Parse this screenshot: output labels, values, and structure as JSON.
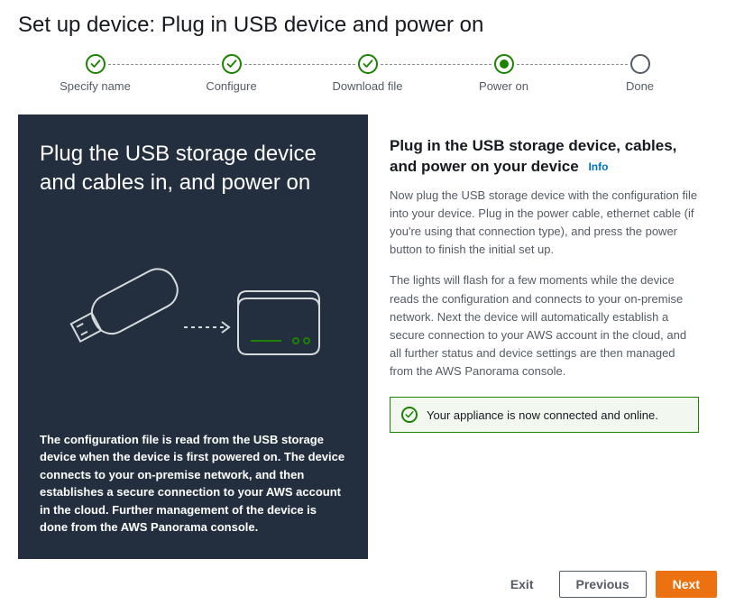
{
  "page": {
    "title": "Set up device: Plug in USB device and power on"
  },
  "stepper": {
    "steps": [
      {
        "label": "Specify name",
        "state": "done"
      },
      {
        "label": "Configure",
        "state": "done"
      },
      {
        "label": "Download file",
        "state": "done"
      },
      {
        "label": "Power on",
        "state": "current"
      },
      {
        "label": "Done",
        "state": "future"
      }
    ]
  },
  "left": {
    "title": "Plug the USB storage device and cables in, and power on",
    "caption": "The configuration file is read from the USB storage device when the device is first powered on. The device connects to your on-premise network, and then establishes a secure connection to your AWS account in the cloud. Further management of the device is done from the AWS Panorama console."
  },
  "right": {
    "title": "Plug in the USB storage device, cables, and power on your device",
    "info_label": "Info",
    "para1": "Now plug the USB storage device with the configuration file into your device. Plug in the power cable, ethernet cable (if you're using that connection type), and press the power button to finish the initial set up.",
    "para2": "The lights will flash for a few moments while the device reads the configuration and connects to your on-premise network. Next the device will automatically establish a secure connection to your AWS account in the cloud, and all further status and device settings are then managed from the AWS Panorama console.",
    "alert": "Your appliance is now connected and online."
  },
  "footer": {
    "exit": "Exit",
    "previous": "Previous",
    "next": "Next"
  }
}
